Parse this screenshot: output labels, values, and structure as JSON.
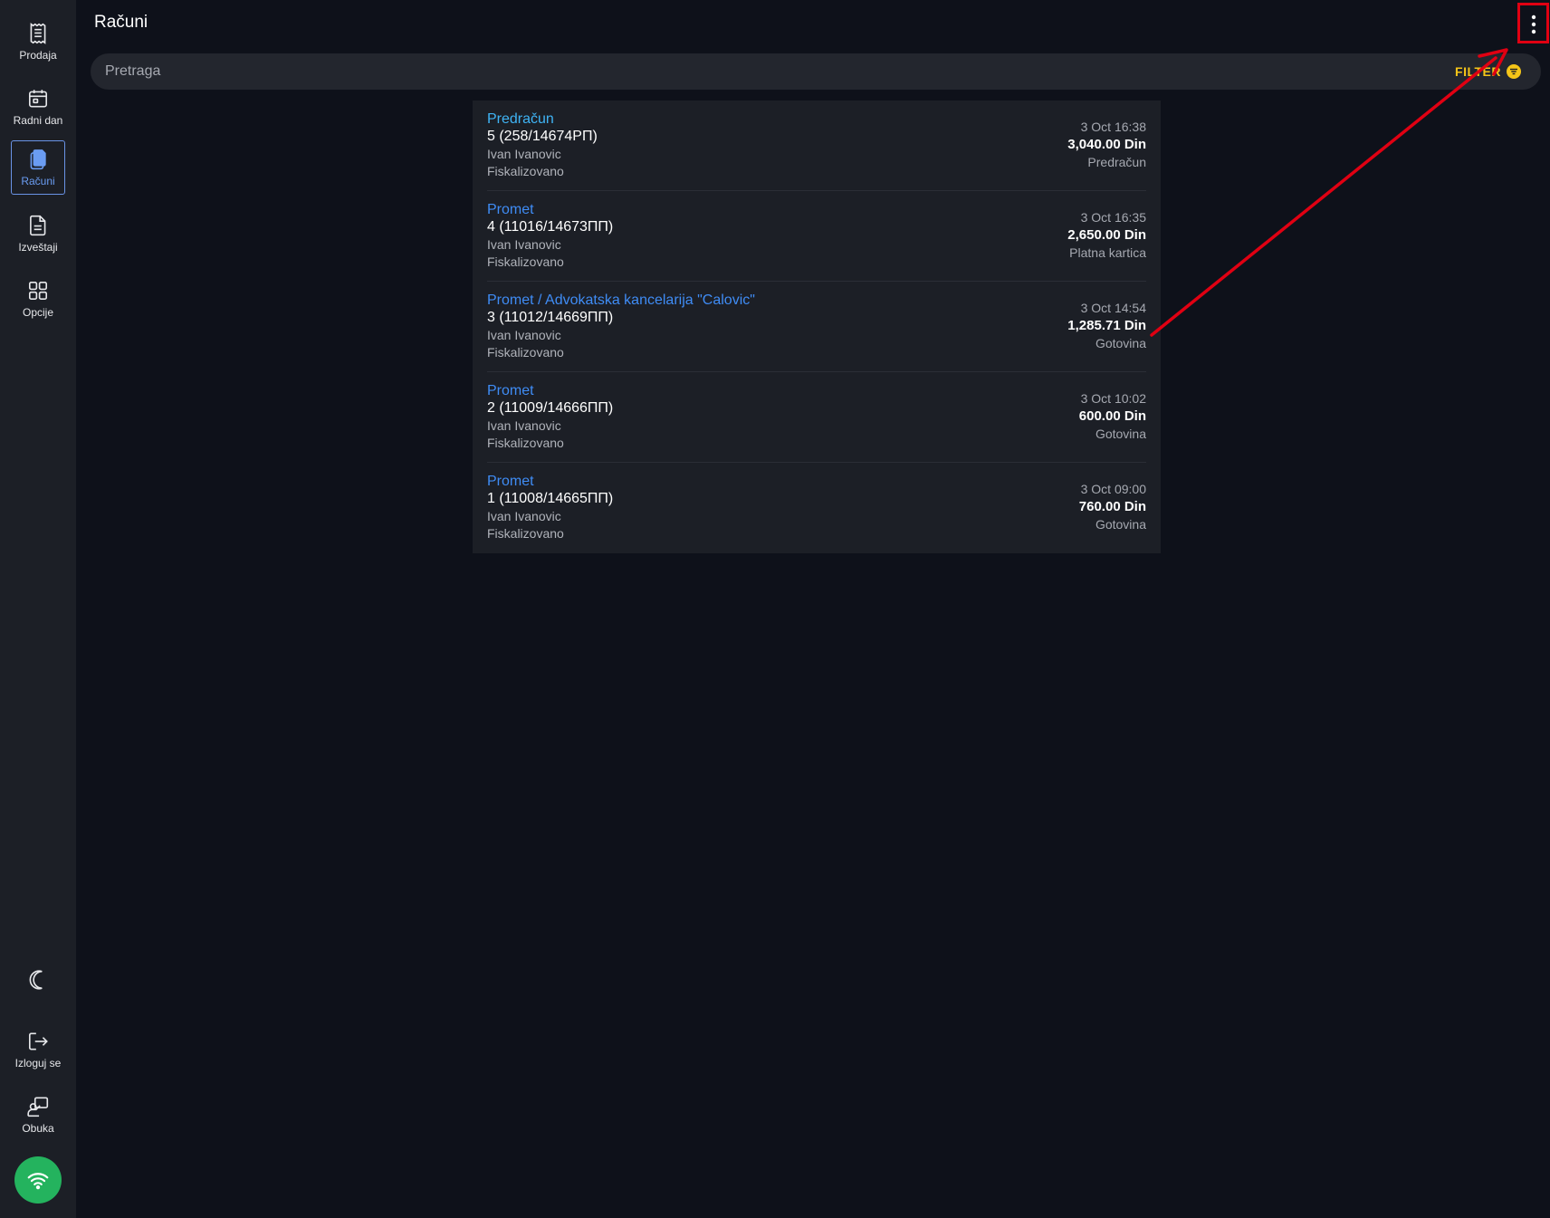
{
  "header": {
    "title": "Računi"
  },
  "sidebar": {
    "items": [
      {
        "label": "Prodaja",
        "icon": "receipt-icon"
      },
      {
        "label": "Radni dan",
        "icon": "calendar-icon"
      },
      {
        "label": "Računi",
        "icon": "documents-icon",
        "active": true
      },
      {
        "label": "Izveštaji",
        "icon": "report-icon"
      },
      {
        "label": "Opcije",
        "icon": "grid-icon"
      }
    ],
    "bottom": [
      {
        "label": "",
        "icon": "moon-icon"
      },
      {
        "label": "Izloguj se",
        "icon": "logout-icon"
      },
      {
        "label": "Obuka",
        "icon": "training-icon"
      }
    ],
    "status": {
      "icon": "wifi-icon",
      "color": "#24b35e"
    }
  },
  "search": {
    "placeholder": "Pretraga",
    "value": "",
    "filter_label": "FILTER"
  },
  "receipts": [
    {
      "type": "Predračun",
      "number": "5 (258/14674РП)",
      "cashier": "Ivan Ivanovic",
      "status": "Fiskalizovano",
      "time": "3 Oct 16:38",
      "amount": "3,040.00 Din",
      "method": "Predračun"
    },
    {
      "type": "Promet",
      "number": "4 (11016/14673ПП)",
      "cashier": "Ivan Ivanovic",
      "status": "Fiskalizovano",
      "time": "3 Oct 16:35",
      "amount": "2,650.00 Din",
      "method": "Platna kartica"
    },
    {
      "type": "Promet / Advokatska kancelarija \"Calovic\"",
      "number": "3 (11012/14669ПП)",
      "cashier": "Ivan Ivanovic",
      "status": "Fiskalizovano",
      "time": "3 Oct 14:54",
      "amount": "1,285.71 Din",
      "method": "Gotovina"
    },
    {
      "type": "Promet",
      "number": "2 (11009/14666ПП)",
      "cashier": "Ivan Ivanovic",
      "status": "Fiskalizovano",
      "time": "3 Oct 10:02",
      "amount": "600.00 Din",
      "method": "Gotovina"
    },
    {
      "type": "Promet",
      "number": "1 (11008/14665ПП)",
      "cashier": "Ivan Ivanovic",
      "status": "Fiskalizovano",
      "time": "3 Oct 09:00",
      "amount": "760.00 Din",
      "method": "Gotovina"
    }
  ],
  "colors": {
    "accent": "#3f8cf5",
    "filter": "#f5c518",
    "annotation": "#e00012"
  }
}
